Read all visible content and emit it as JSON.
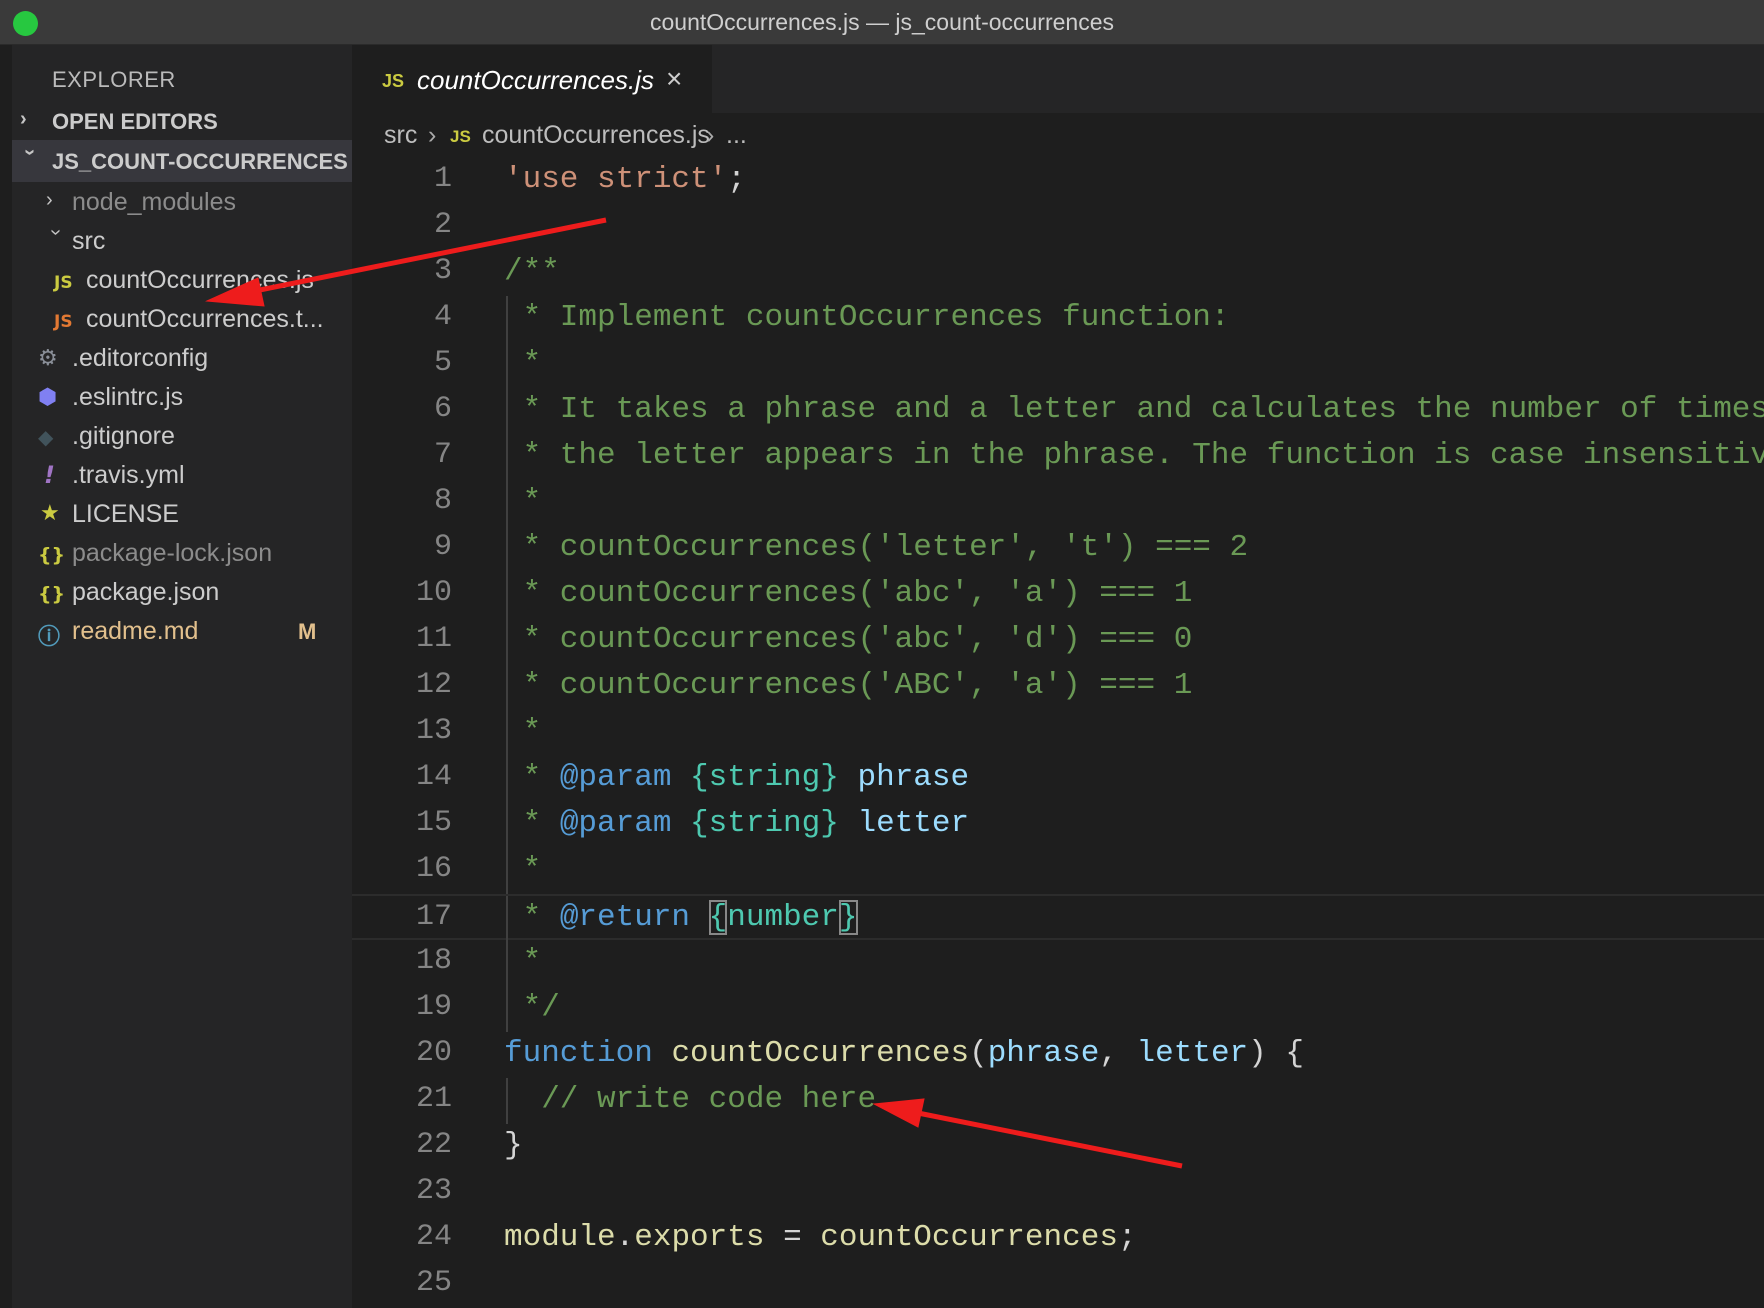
{
  "window": {
    "title": "countOccurrences.js — js_count-occurrences"
  },
  "sidebar": {
    "header": "EXPLORER",
    "sections": {
      "open_editors": "OPEN EDITORS",
      "project": "JS_COUNT-OCCURRENCES"
    },
    "tree": [
      {
        "label": "node_modules",
        "icon": "chevron-right"
      },
      {
        "label": "src",
        "icon": "chevron-down"
      },
      {
        "label": "countOccurrences.js",
        "icon": "js"
      },
      {
        "label": "countOccurrences.t...",
        "icon": "js-test"
      },
      {
        "label": ".editorconfig",
        "icon": "gear"
      },
      {
        "label": ".eslintrc.js",
        "icon": "eslint"
      },
      {
        "label": ".gitignore",
        "icon": "git"
      },
      {
        "label": ".travis.yml",
        "icon": "exclamation"
      },
      {
        "label": "LICENSE",
        "icon": "license"
      },
      {
        "label": "package-lock.json",
        "icon": "json"
      },
      {
        "label": "package.json",
        "icon": "json"
      },
      {
        "label": "readme.md",
        "icon": "info",
        "badge": "M"
      }
    ]
  },
  "tab": {
    "label": "countOccurrences.js",
    "js_badge": "JS"
  },
  "breadcrumbs": {
    "folder": "src",
    "file": "countOccurrences.js",
    "more": "..."
  },
  "lines": [
    {
      "n": "1",
      "parts": [
        [
          "'use strict'",
          "str"
        ],
        [
          ";",
          "pun"
        ]
      ]
    },
    {
      "n": "2",
      "parts": []
    },
    {
      "n": "3",
      "parts": [
        [
          "/**",
          "cmt"
        ]
      ]
    },
    {
      "n": "4",
      "parts": [
        [
          " * Implement countOccurrences function:",
          "cmt"
        ]
      ]
    },
    {
      "n": "5",
      "parts": [
        [
          " *",
          "cmt"
        ]
      ]
    },
    {
      "n": "6",
      "parts": [
        [
          " * It takes a phrase and a letter and calculates the number of times",
          "cmt"
        ]
      ]
    },
    {
      "n": "7",
      "parts": [
        [
          " * the letter appears in the phrase. The function is case insensitive.",
          "cmt"
        ]
      ]
    },
    {
      "n": "8",
      "parts": [
        [
          " *",
          "cmt"
        ]
      ]
    },
    {
      "n": "9",
      "parts": [
        [
          " * countOccurrences('letter', 't') === 2",
          "cmt"
        ]
      ]
    },
    {
      "n": "10",
      "parts": [
        [
          " * countOccurrences('abc', 'a') === 1",
          "cmt"
        ]
      ]
    },
    {
      "n": "11",
      "parts": [
        [
          " * countOccurrences('abc', 'd') === 0",
          "cmt"
        ]
      ]
    },
    {
      "n": "12",
      "parts": [
        [
          " * countOccurrences('ABC', 'a') === 1",
          "cmt"
        ]
      ]
    },
    {
      "n": "13",
      "parts": [
        [
          " *",
          "cmt"
        ]
      ]
    },
    {
      "n": "14",
      "parts": [
        [
          " * ",
          "cmt"
        ],
        [
          "@param",
          "tag"
        ],
        [
          " ",
          "cmt"
        ],
        [
          "{string}",
          "type"
        ],
        [
          " ",
          "cmt"
        ],
        [
          "phrase",
          "var"
        ]
      ]
    },
    {
      "n": "15",
      "parts": [
        [
          " * ",
          "cmt"
        ],
        [
          "@param",
          "tag"
        ],
        [
          " ",
          "cmt"
        ],
        [
          "{string}",
          "type"
        ],
        [
          " ",
          "cmt"
        ],
        [
          "letter",
          "var"
        ]
      ]
    },
    {
      "n": "16",
      "parts": [
        [
          " *",
          "cmt"
        ]
      ]
    },
    {
      "n": "17",
      "parts": [
        [
          " * ",
          "cmt"
        ],
        [
          "@return",
          "tag"
        ],
        [
          " ",
          "cmt"
        ],
        [
          "{",
          "type-box"
        ],
        [
          "number",
          "type"
        ],
        [
          "}",
          "type-box"
        ]
      ]
    },
    {
      "n": "18",
      "parts": [
        [
          " *",
          "cmt"
        ]
      ]
    },
    {
      "n": "19",
      "parts": [
        [
          " */",
          "cmt"
        ]
      ]
    },
    {
      "n": "20",
      "parts": [
        [
          "function",
          "kw"
        ],
        [
          " ",
          "pun"
        ],
        [
          "countOccurrences",
          "fn"
        ],
        [
          "(",
          "pun"
        ],
        [
          "phrase",
          "var"
        ],
        [
          ", ",
          "pun"
        ],
        [
          "letter",
          "var"
        ],
        [
          ") {",
          "pun"
        ]
      ]
    },
    {
      "n": "21",
      "parts": [
        [
          "  // write code here",
          "cmt"
        ]
      ]
    },
    {
      "n": "22",
      "parts": [
        [
          "}",
          "pun"
        ]
      ]
    },
    {
      "n": "23",
      "parts": []
    },
    {
      "n": "24",
      "parts": [
        [
          "module",
          "fn"
        ],
        [
          ".",
          "pun"
        ],
        [
          "exports",
          "fn"
        ],
        [
          " = ",
          "pun"
        ],
        [
          "countOccurrences",
          "fn"
        ],
        [
          ";",
          "pun"
        ]
      ]
    },
    {
      "n": "25",
      "parts": []
    }
  ],
  "colors": {
    "annotation_arrow": "#ee1c1c",
    "js_icon": "#cbcb41",
    "modified": "#e2c08d"
  }
}
